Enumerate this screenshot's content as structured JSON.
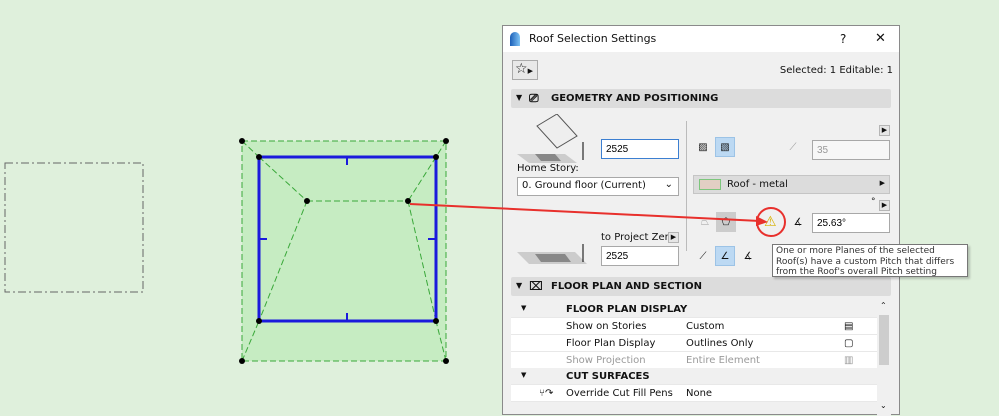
{
  "dialog": {
    "title": "Roof Selection Settings",
    "help": "?",
    "close": "✕",
    "selection_info": "Selected: 1 Editable: 1"
  },
  "geometry": {
    "header": "GEOMETRY AND POSITIONING",
    "height_value": "2525",
    "home_story_label": "Home Story:",
    "home_story_value": "0. Ground floor (Current)",
    "thickness_value": "35",
    "material": "Roof - metal",
    "degree_unit": "°",
    "pitch_value": "25.63°",
    "ref_label": "to Project Zero",
    "ref_value": "2525"
  },
  "tooltip": {
    "text": "One or more Planes of the selected Roof(s) have a custom Pitch that differs from the Roof's overall Pitch setting"
  },
  "floorplan": {
    "header": "FLOOR PLAN AND SECTION",
    "groups": [
      {
        "label": "FLOOR PLAN DISPLAY"
      },
      {
        "label": "CUT SURFACES"
      }
    ],
    "rows": [
      {
        "name": "Show on Stories",
        "value": "Custom"
      },
      {
        "name": "Floor Plan Display",
        "value": "Outlines Only"
      },
      {
        "name": "Show Projection",
        "value": "Entire Element"
      },
      {
        "name": "Override Cut Fill Pens",
        "value": "None"
      }
    ]
  },
  "colors": {
    "accent_red": "#e8302c",
    "plan_blue": "#1a1adc",
    "plan_green": "#3aa83a"
  }
}
